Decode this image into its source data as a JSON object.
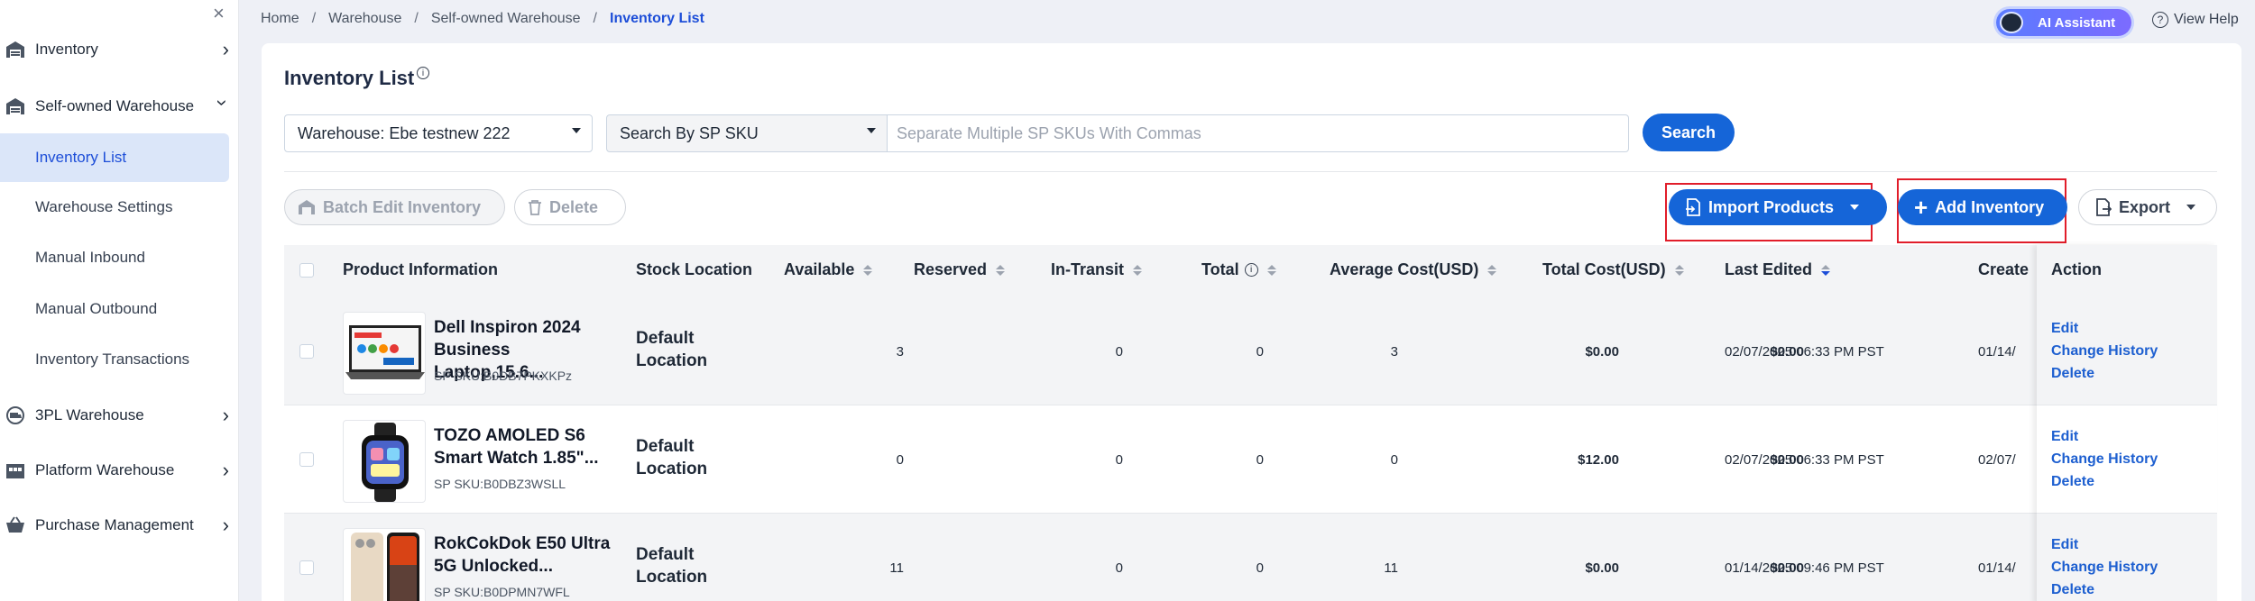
{
  "sidebar": {
    "items": [
      {
        "label": "Inventory"
      },
      {
        "label": "Self-owned Warehouse"
      },
      {
        "label": "3PL Warehouse"
      },
      {
        "label": "Platform Warehouse"
      },
      {
        "label": "Purchase Management"
      }
    ],
    "sub_items": [
      {
        "label": "Inventory List"
      },
      {
        "label": "Warehouse Settings"
      },
      {
        "label": "Manual Inbound"
      },
      {
        "label": "Manual Outbound"
      },
      {
        "label": "Inventory Transactions"
      }
    ]
  },
  "breadcrumb": [
    "Home",
    "Warehouse",
    "Self-owned Warehouse",
    "Inventory List"
  ],
  "header": {
    "ai_label": "AI Assistant",
    "help_label": "View Help"
  },
  "page": {
    "title": "Inventory List"
  },
  "filters": {
    "warehouse": "Warehouse: Ebe testnew 222",
    "search_by": "Search By SP SKU",
    "search_placeholder": "Separate Multiple SP SKUs With Commas",
    "search_label": "Search"
  },
  "toolbar": {
    "batch_edit": "Batch Edit Inventory",
    "delete": "Delete",
    "import": "Import Products",
    "add": "Add Inventory",
    "export": "Export"
  },
  "table": {
    "headers": {
      "product": "Product Information",
      "location": "Stock Location",
      "available": "Available",
      "reserved": "Reserved",
      "transit": "In-Transit",
      "total": "Total",
      "avg_cost": "Average Cost(USD)",
      "total_cost": "Total Cost(USD)",
      "last_edited": "Last Edited",
      "create": "Create",
      "action": "Action"
    },
    "rows": [
      {
        "name1": "Dell Inspiron 2024",
        "name2": "Business Laptop,15.6...",
        "sku": "SP SKU:B0DB7PKXKPz",
        "loc1": "Default",
        "loc2": "Location",
        "available": "3",
        "reserved": "0",
        "transit": "0",
        "total": "3",
        "avg_cost": "$0.00",
        "total_cost": "$0.00",
        "last_edited": "02/07/2025 06:33 PM PST",
        "created": "01/14/"
      },
      {
        "name1": "TOZO AMOLED S6",
        "name2": "Smart Watch 1.85\"...",
        "sku": "SP SKU:B0DBZ3WSLL",
        "loc1": "Default",
        "loc2": "Location",
        "available": "0",
        "reserved": "0",
        "transit": "0",
        "total": "0",
        "avg_cost": "$12.00",
        "total_cost": "$0.00",
        "last_edited": "02/07/2025 06:33 PM PST",
        "created": "02/07/"
      },
      {
        "name1": "RokCokDok E50 Ultra",
        "name2": "5G Unlocked...",
        "sku": "SP SKU:B0DPMN7WFL",
        "loc1": "Default",
        "loc2": "Location",
        "available": "11",
        "reserved": "0",
        "transit": "0",
        "total": "11",
        "avg_cost": "$0.00",
        "total_cost": "$0.00",
        "last_edited": "01/14/2025 09:46 PM PST",
        "created": "01/14/"
      }
    ],
    "actions": [
      "Edit",
      "Change History",
      "Delete"
    ]
  },
  "colors": {
    "primary": "#1565d8",
    "highlight": "#e11d2a",
    "active_bg": "#dbe6f9"
  }
}
